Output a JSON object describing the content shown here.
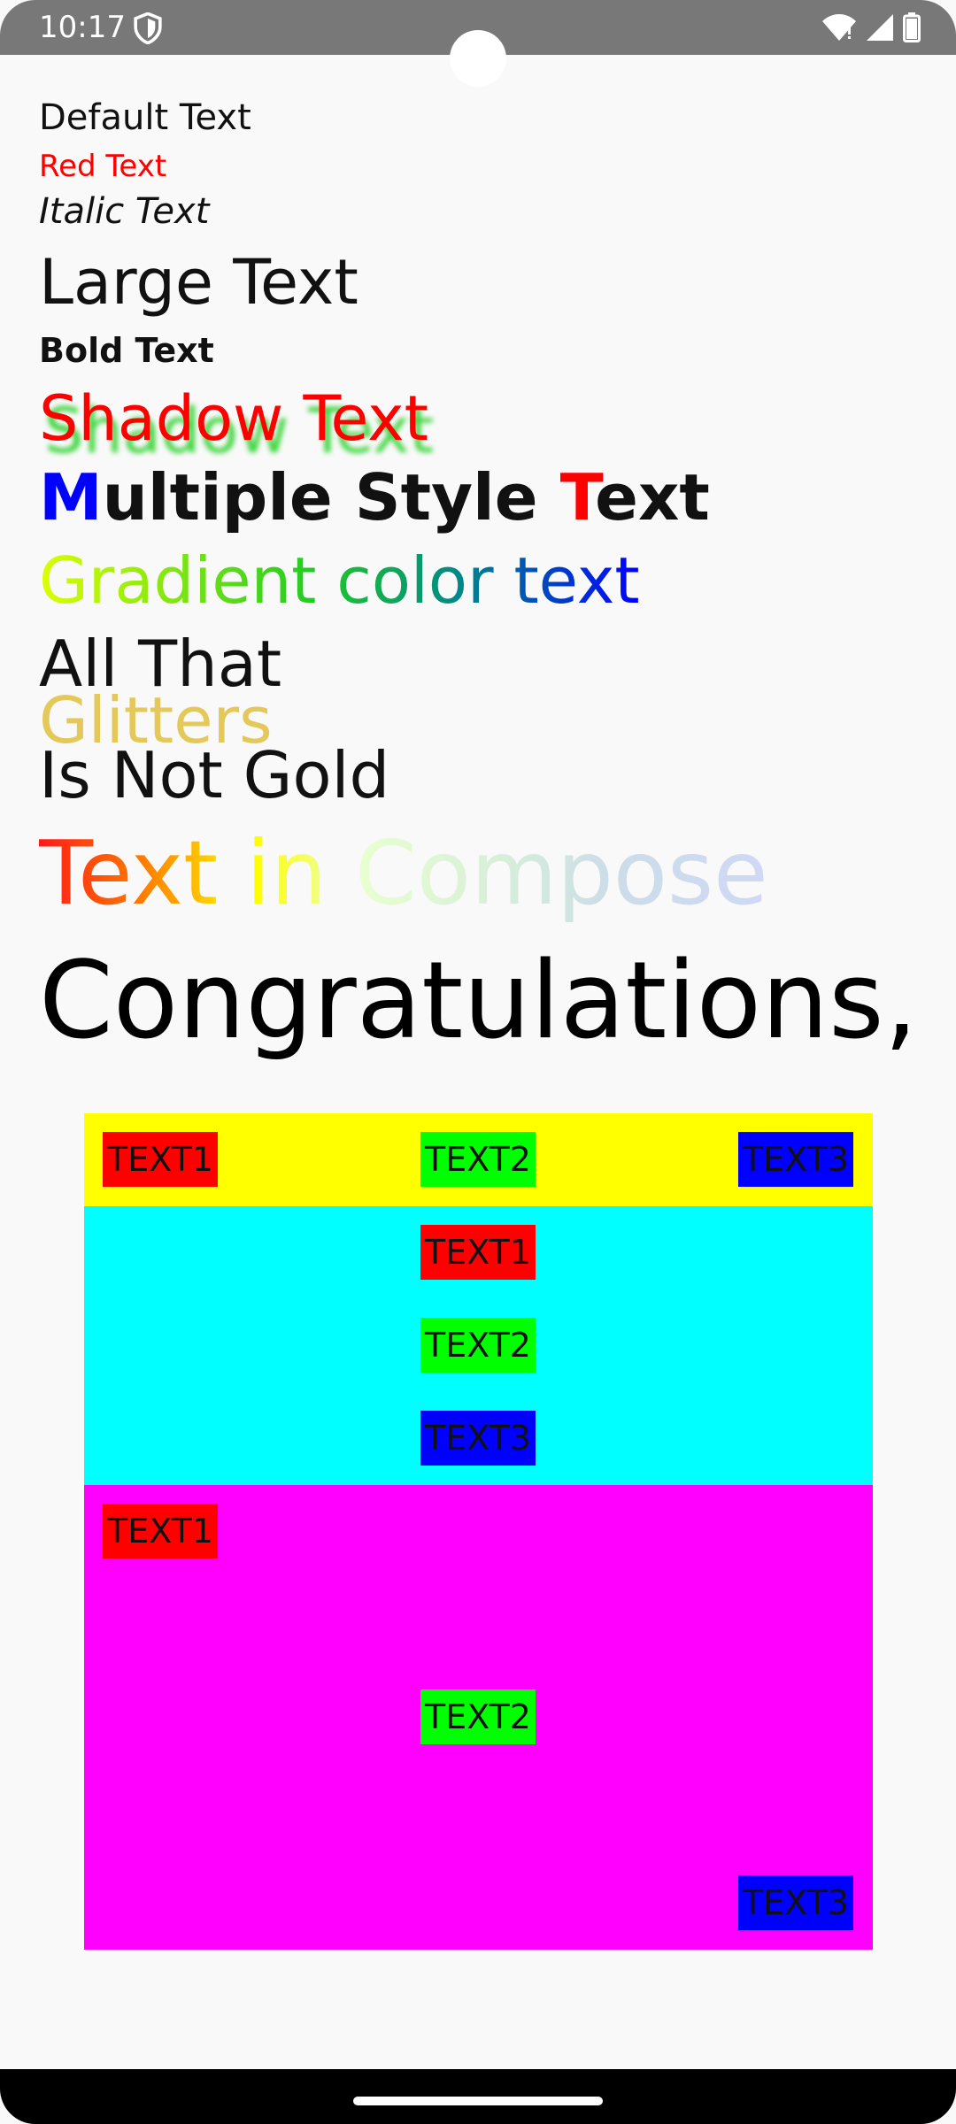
{
  "status_bar": {
    "time": "10:17",
    "icons": [
      "shield-icon",
      "wifi-icon",
      "signal-icon",
      "battery-icon"
    ]
  },
  "texts": {
    "default": "Default Text",
    "red": "Red Text",
    "italic": "Italic Text",
    "large": "Large Text",
    "bold": "Bold Text",
    "shadow": "Shadow Text",
    "multi_style": {
      "first_letter": "M",
      "middle": "ultiple Style ",
      "accent_letter": "T",
      "end": "ext"
    },
    "gradient": "Gradient color text",
    "glitters": {
      "line1": "All That",
      "line2": "Glitters",
      "line3": "Is Not Gold"
    },
    "rainbow": "Text in Compose",
    "congrats": "Congratulations,"
  },
  "row_box": {
    "items": [
      "TEXT1",
      "TEXT2",
      "TEXT3"
    ]
  },
  "column_box": {
    "items": [
      "TEXT1",
      "TEXT2",
      "TEXT3"
    ]
  },
  "stack_box": {
    "items": [
      "TEXT1",
      "TEXT2",
      "TEXT3"
    ]
  },
  "colors": {
    "background": "#f9f9f9",
    "row_background": "#ffff00",
    "column_background": "#00ffff",
    "stack_background": "#ff00ff",
    "chip_red": "#ff0000",
    "chip_green": "#00ff00",
    "chip_blue": "#0000ff"
  }
}
